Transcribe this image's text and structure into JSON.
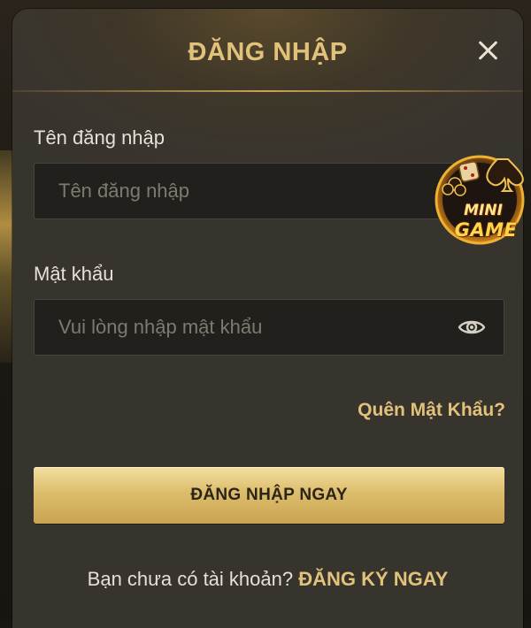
{
  "modal": {
    "title": "ĐĂNG NHẬP"
  },
  "username": {
    "label": "Tên đăng nhập",
    "placeholder": "Tên đăng nhập",
    "value": ""
  },
  "password": {
    "label": "Mật khẩu",
    "placeholder": "Vui lòng nhập mật khẩu",
    "value": ""
  },
  "forgot_password": "Quên Mật Khẩu?",
  "login_button": "ĐĂNG NHẬP NGAY",
  "register": {
    "prompt": "Bạn chưa có tài khoản?",
    "link": "ĐĂNG KÝ NGAY"
  },
  "minigame_badge": {
    "line1": "MINI",
    "line2": "GAME"
  },
  "colors": {
    "accent_gold": "#e1c27a",
    "button_gold": "#dcbd6c",
    "panel_bg": "#3a352d",
    "input_bg": "#22201c"
  },
  "icons": {
    "close": "close-icon",
    "eye": "eye-icon"
  }
}
